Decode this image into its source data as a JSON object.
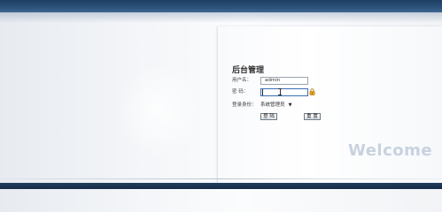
{
  "login": {
    "title": "后台管理",
    "username_label": "用户名：",
    "username_value": "admin",
    "password_label": "密 码：",
    "password_value": "",
    "role_label": "登录身份：",
    "role_selected": "系统管理员",
    "role_arrow": "▼",
    "login_button": "登 陆",
    "reset_button": "重 置"
  },
  "welcome_text": "Welcome",
  "icons": {
    "lock": "lock-icon",
    "cursor": "text-cursor-icon"
  },
  "colors": {
    "header": "#1f3e62",
    "welcome": "#c8d2df",
    "lock": "#e3a21a"
  }
}
